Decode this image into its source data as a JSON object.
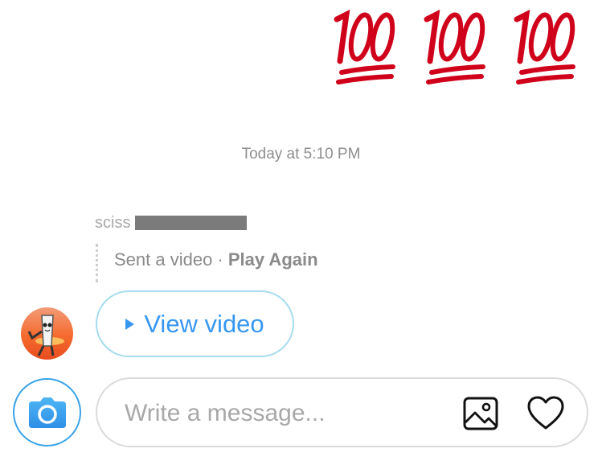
{
  "messages": {
    "emoji_reaction": {
      "glyph": "💯",
      "count": 3,
      "icon": "hundred-points-icon",
      "color": "#d0021b"
    },
    "timestamp": "Today at 5:10 PM",
    "sender_name_visible": "sciss",
    "video_status": {
      "sent": "Sent a video",
      "separator": " · ",
      "play_again": "Play Again"
    },
    "view_video_label": "View video"
  },
  "composer": {
    "placeholder": "Write a message...",
    "value": "",
    "icons": [
      "camera-icon",
      "gallery-icon",
      "heart-icon"
    ]
  },
  "colors": {
    "accent": "#3797f0",
    "emoji_red": "#d0021b",
    "muted_text": "#8e8e8e"
  }
}
